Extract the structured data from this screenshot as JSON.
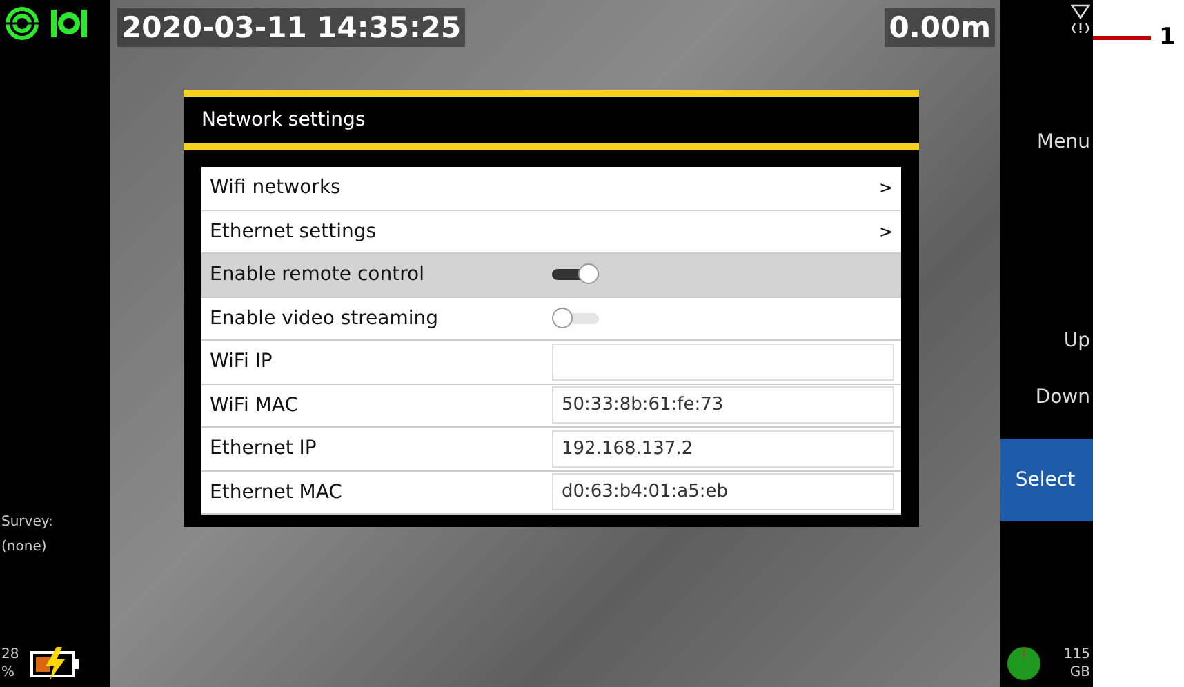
{
  "overlay": {
    "datetime": "2020-03-11 14:35:25",
    "distance": "0.00m"
  },
  "dialog": {
    "title": "Network settings",
    "rows": [
      {
        "kind": "link",
        "label": "Wifi networks",
        "arrow": ">",
        "selected": false
      },
      {
        "kind": "link",
        "label": "Ethernet settings",
        "arrow": ">",
        "selected": false
      },
      {
        "kind": "toggle",
        "label": "Enable remote control",
        "on": true,
        "selected": true
      },
      {
        "kind": "toggle",
        "label": "Enable video streaming",
        "on": false,
        "selected": false
      },
      {
        "kind": "field",
        "label": "WiFi IP",
        "selected": false
      },
      {
        "kind": "field",
        "label": "WiFi MAC",
        "value": "50:33:8b:61:fe:73",
        "selected": false
      },
      {
        "kind": "field",
        "label": "Ethernet IP",
        "value": "192.168.137.2",
        "selected": false
      },
      {
        "kind": "field",
        "label": "Ethernet MAC",
        "value": "d0:63:b4:01:a5:eb",
        "selected": false
      }
    ]
  },
  "left_panel": {
    "survey_label": "Survey:",
    "survey_value": "(none)",
    "battery_percent": "28",
    "battery_unit": "%"
  },
  "right_panel": {
    "buttons": [
      {
        "label": "Menu",
        "selected": false
      },
      {
        "label": "Up",
        "selected": false
      },
      {
        "label": "Down",
        "selected": false
      },
      {
        "label": "Select",
        "selected": true
      }
    ],
    "storage_amount": "115",
    "storage_unit": "GB"
  },
  "callout": {
    "number": "1"
  }
}
